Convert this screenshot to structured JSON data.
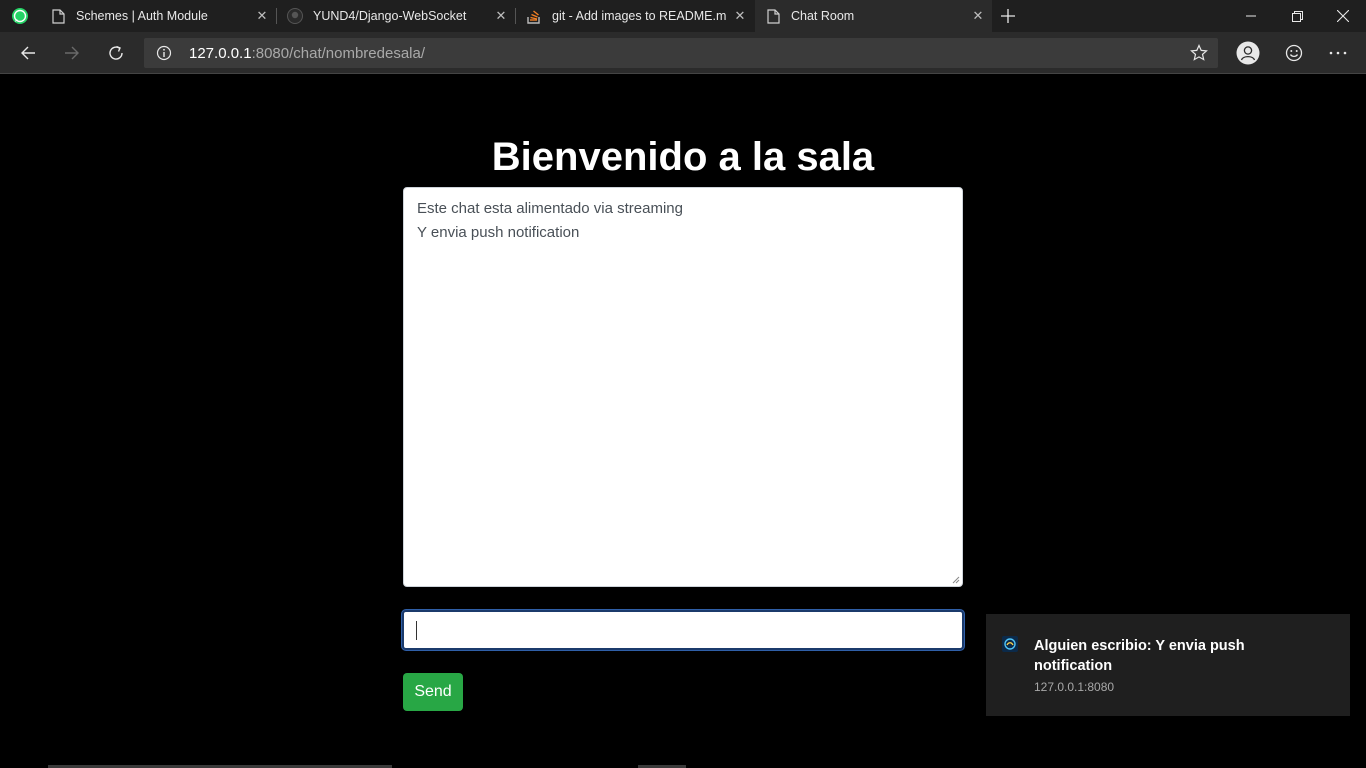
{
  "browser": {
    "tabs": [
      {
        "title": "Schemes | Auth Module",
        "icon": "page-icon",
        "active": false
      },
      {
        "title": "YUND4/Django-WebSocket",
        "icon": "github-icon",
        "active": false
      },
      {
        "title": "git - Add images to README.md",
        "icon": "stackoverflow-icon",
        "active": false
      },
      {
        "title": "Chat Room",
        "icon": "page-icon",
        "active": true
      }
    ],
    "pinned_tab_icon": "whatsapp-icon",
    "address": {
      "host": "127.0.0.1",
      "rest": ":8080/chat/nombredesala/"
    }
  },
  "page": {
    "title": "Bienvenido a la sala",
    "chat_log": [
      "Este chat esta alimentado via streaming",
      "Y envia push notification"
    ],
    "input_value": "",
    "send_label": "Send"
  },
  "notification": {
    "title": "Alguien escribio: Y envia push notification",
    "source": "127.0.0.1:8080"
  },
  "colors": {
    "send_button": "#28a745",
    "page_background": "#000000",
    "input_focus": "#1b3a6b"
  }
}
